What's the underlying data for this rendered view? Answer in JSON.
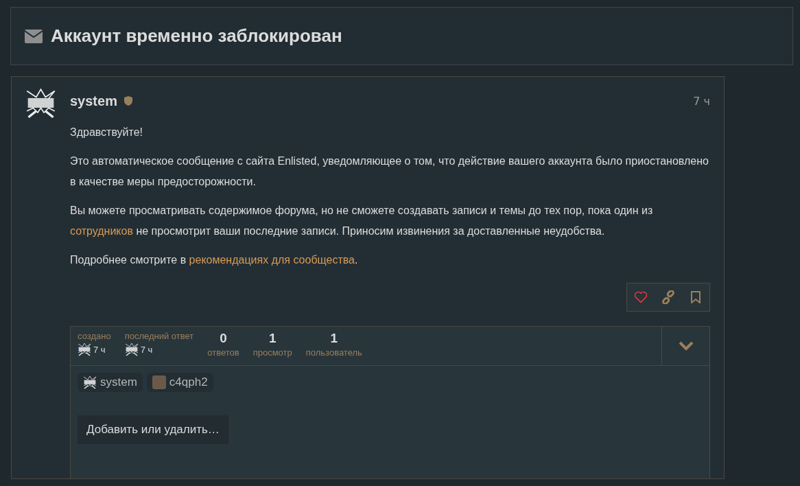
{
  "topic": {
    "title": "Аккаунт временно заблокирован"
  },
  "post": {
    "username": "system",
    "time": "7 ч",
    "paragraphs": [
      [
        {
          "kind": "text",
          "text": "Здравствуйте!"
        }
      ],
      [
        {
          "kind": "text",
          "text": "Это автоматическое сообщение с сайта Enlisted, уведомляющее о том, что действие вашего аккаунта было приостановлено в качестве меры предосторожности."
        }
      ],
      [
        {
          "kind": "text",
          "text": "Вы можете просматривать содержимое форума, но не сможете создавать записи и темы до тех пор, пока один из "
        },
        {
          "kind": "link",
          "text": "сотрудников"
        },
        {
          "kind": "text",
          "text": " не просмотрит ваши последние записи. Приносим извинения за доставленные неудобства."
        }
      ],
      [
        {
          "kind": "text",
          "text": "Подробнее смотрите в "
        },
        {
          "kind": "link",
          "text": "рекомендациях для сообщества"
        },
        {
          "kind": "text",
          "text": "."
        }
      ]
    ]
  },
  "summary": {
    "created": {
      "label": "создано",
      "time": "7 ч"
    },
    "last_reply": {
      "label": "последний ответ",
      "time": "7 ч"
    },
    "stats": [
      {
        "value": "0",
        "label": "ответов"
      },
      {
        "value": "1",
        "label": "просмотр"
      },
      {
        "value": "1",
        "label": "пользователь"
      }
    ]
  },
  "participants": [
    {
      "name": "system",
      "kind": "forum"
    },
    {
      "name": "c4qph2",
      "kind": "photo"
    }
  ],
  "add_button": "Добавить или удалить…"
}
